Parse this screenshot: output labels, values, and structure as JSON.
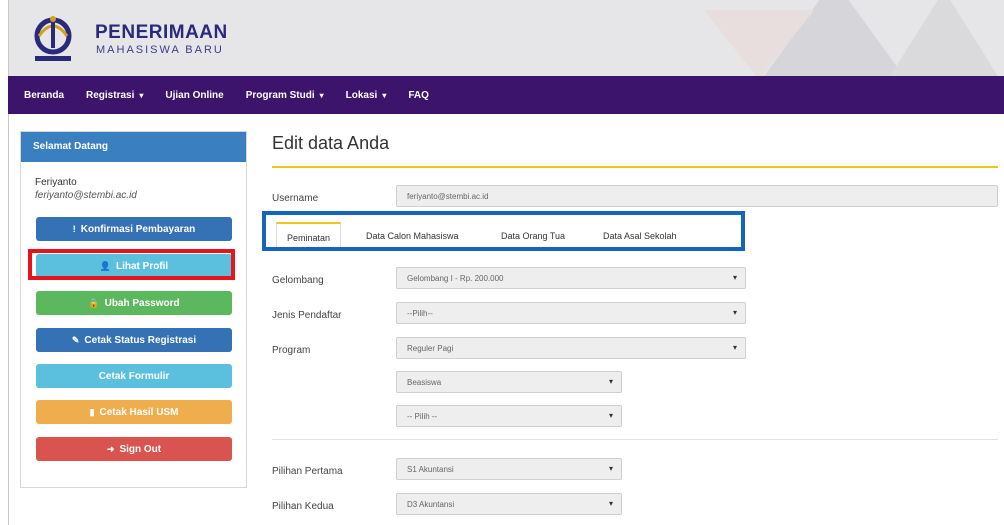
{
  "header": {
    "brand_title": "PENERIMAAN",
    "brand_subtitle": "MAHASISWA BARU"
  },
  "nav": {
    "items": [
      {
        "label": "Beranda",
        "dropdown": false
      },
      {
        "label": "Registrasi",
        "dropdown": true
      },
      {
        "label": "Ujian Online",
        "dropdown": false
      },
      {
        "label": "Program Studi",
        "dropdown": true
      },
      {
        "label": "Lokasi",
        "dropdown": true
      },
      {
        "label": "FAQ",
        "dropdown": false
      }
    ],
    "caret": "▾"
  },
  "sidebar": {
    "heading": "Selamat Datang",
    "user_name": "Feriyanto",
    "user_email": "feriyanto@stembi.ac.id",
    "buttons": [
      {
        "label": "Konfirmasi Pembayaran",
        "icon": "!",
        "icon_name": "exclamation-icon",
        "color": "#3572b5"
      },
      {
        "label": "Lihat Profil",
        "icon": "👤",
        "icon_name": "user-icon",
        "color": "#5bc0de"
      },
      {
        "label": "Ubah Password",
        "icon": "🔒",
        "icon_name": "lock-icon",
        "color": "#5cb85c"
      },
      {
        "label": "Cetak Status Registrasi",
        "icon": "✎",
        "icon_name": "edit-icon",
        "color": "#3572b5"
      },
      {
        "label": "Cetak Formulir",
        "icon": "",
        "icon_name": "",
        "color": "#5bc0de"
      },
      {
        "label": "Cetak Hasil USM",
        "icon": "▮",
        "icon_name": "file-icon",
        "color": "#f0ad4e"
      },
      {
        "label": "Sign Out",
        "icon": "➜",
        "icon_name": "sign-out-icon",
        "color": "#d9534f"
      }
    ]
  },
  "main": {
    "title": "Edit data Anda",
    "username_label": "Username",
    "username_value": "feriyanto@stembi.ac.id",
    "tabs": [
      "Peminatan",
      "Data Calon Mahasiswa",
      "Data Orang Tua",
      "Data Asal Sekolah"
    ],
    "fields": {
      "gelombang_label": "Gelombang",
      "gelombang_value": "Gelombang I - Rp. 200.000",
      "jenis_label": "Jenis Pendaftar",
      "jenis_value": "--Pilih--",
      "program_label": "Program",
      "program_value": "Reguler Pagi",
      "beasiswa_value": "Beasiswa",
      "pilih_value": "-- Pilih --",
      "pilihan1_label": "Pilihan Pertama",
      "pilihan1_value": "S1 Akuntansi",
      "pilihan2_label": "Pilihan Kedua",
      "pilihan2_value": "D3 Akuntansi"
    },
    "select_arrow": "▾"
  },
  "colors": {
    "navbar": "#3d146b",
    "accent_rule": "#f0c419",
    "highlight_red": "#e8141c",
    "highlight_blue": "#1565c0"
  }
}
